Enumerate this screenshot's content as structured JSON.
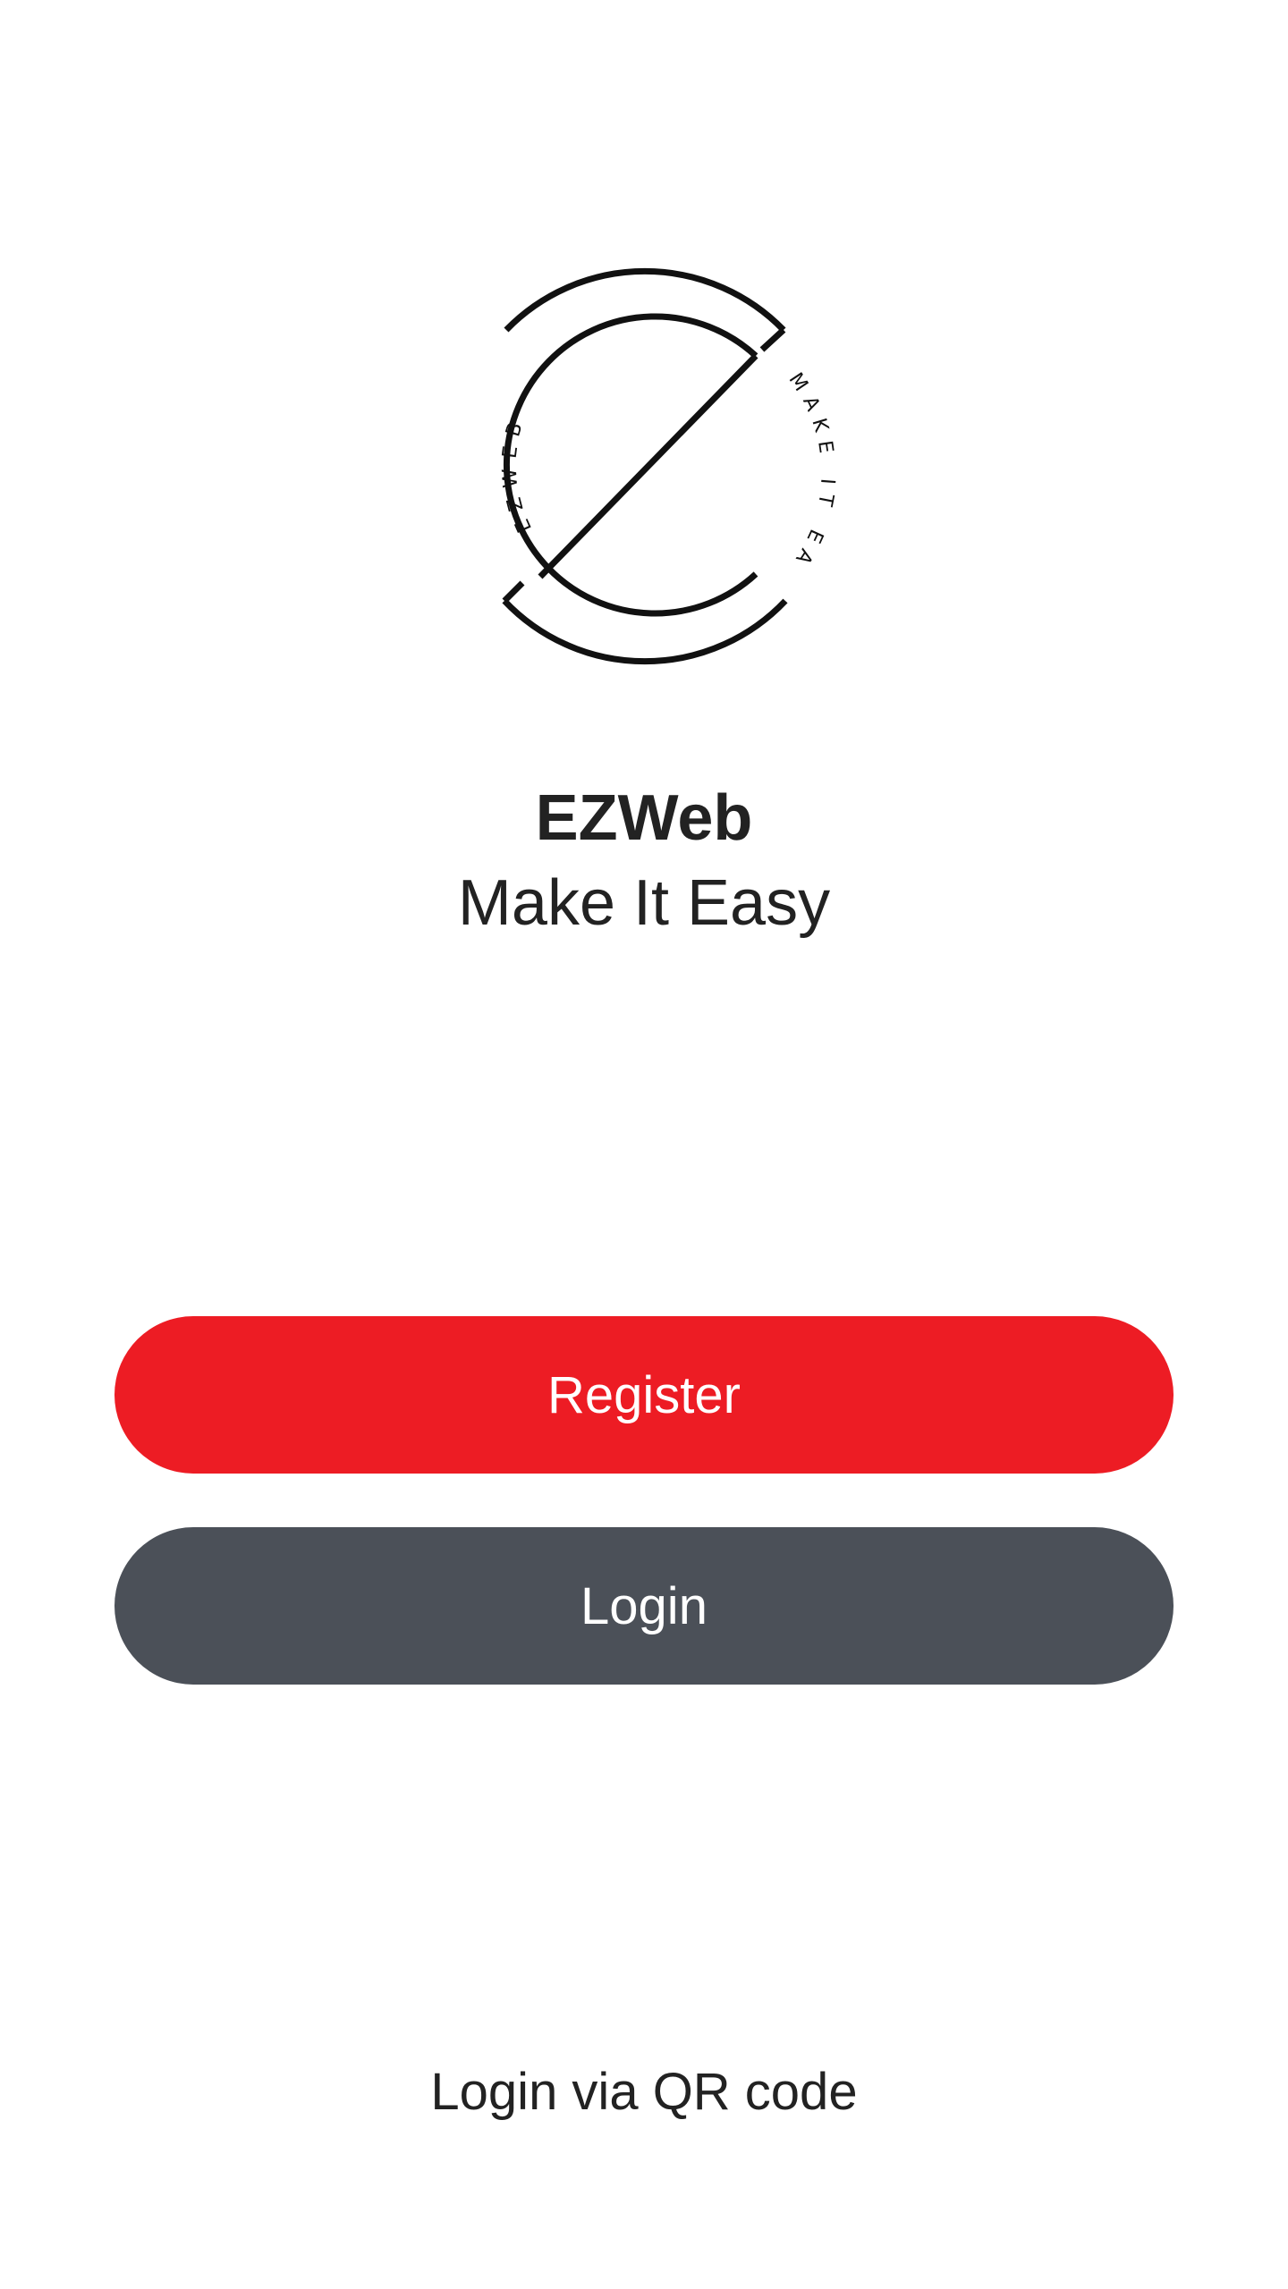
{
  "logo": {
    "ring_text_left": "EZWEB",
    "ring_text_right": "MAKE IT EASY",
    "color": "#111111"
  },
  "header": {
    "app_name": "EZWeb",
    "tagline": "Make It Easy"
  },
  "actions": {
    "register_label": "Register",
    "login_label": "Login",
    "qr_login_label": "Login via QR code"
  },
  "colors": {
    "register": "#ed1c24",
    "login": "#4b5058",
    "background": "#ffffff",
    "text": "#222222"
  }
}
